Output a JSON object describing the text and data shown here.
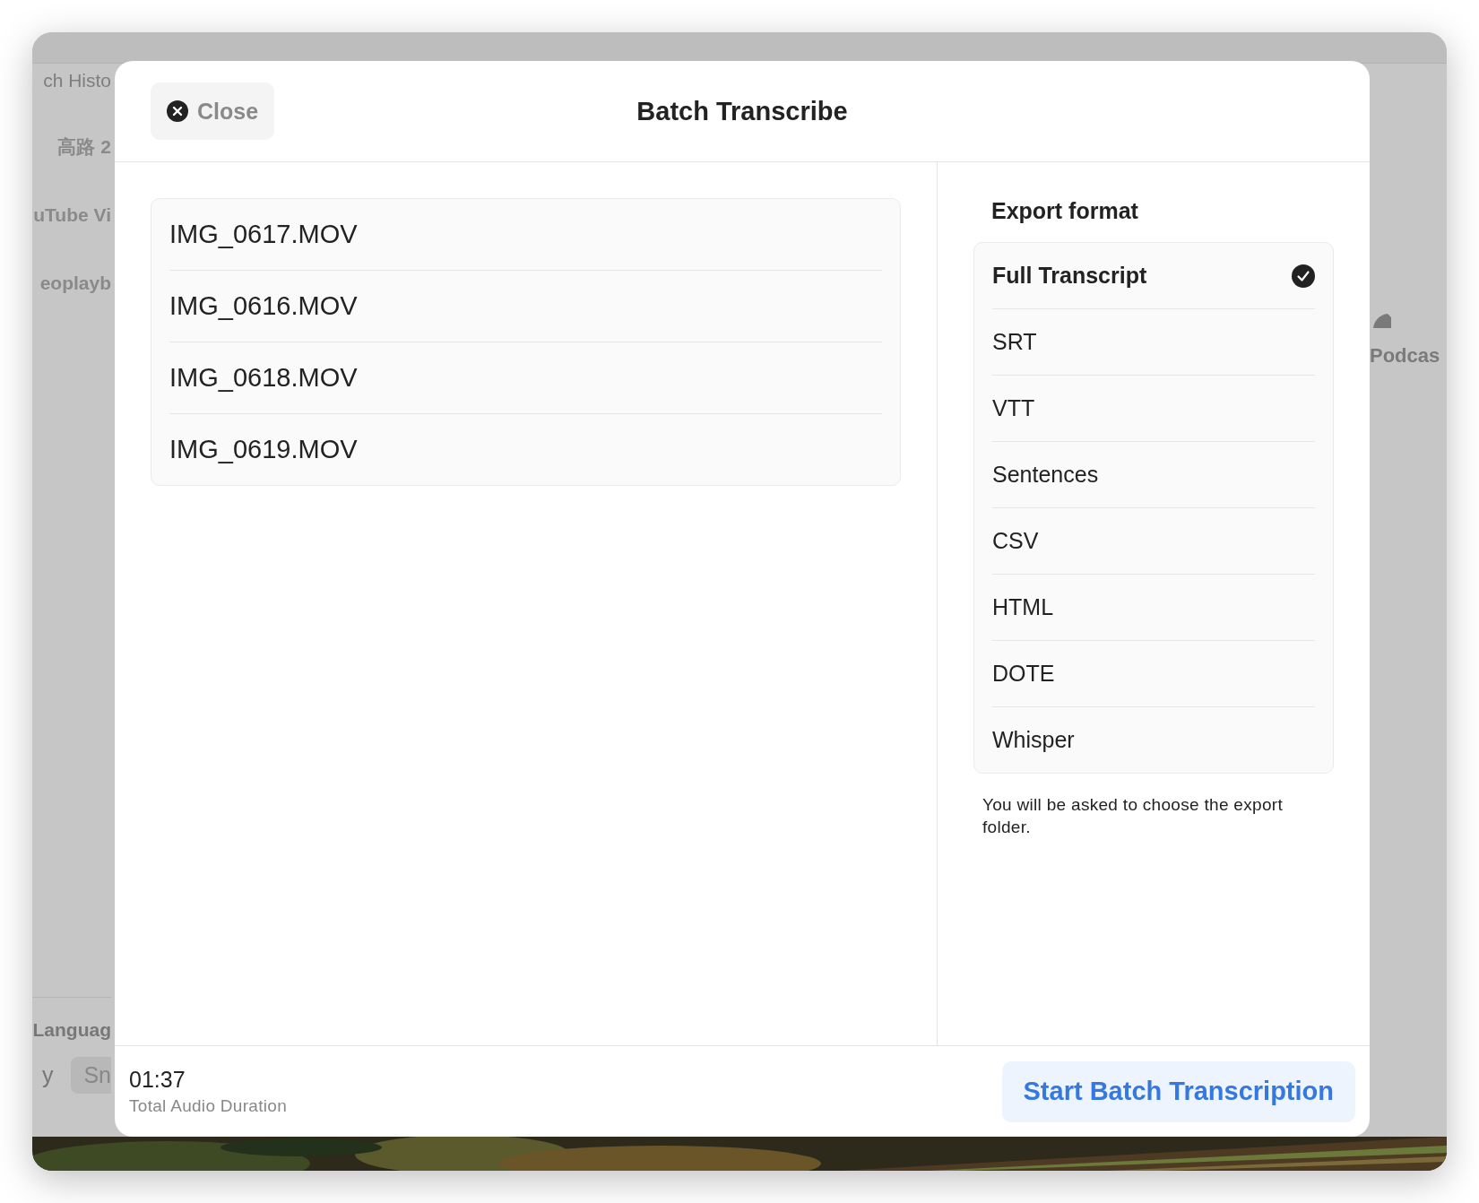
{
  "background": {
    "sidebar_items": [
      "ch Histo",
      "高路 2",
      "uTube Vi",
      "eoplayb"
    ],
    "bottom_heading": "Languag",
    "bottom_items": [
      "y",
      "Sn"
    ],
    "right_label": "Podcas"
  },
  "dialog": {
    "close_button": "Close",
    "title": "Batch Transcribe",
    "files": [
      "IMG_0617.MOV",
      "IMG_0616.MOV",
      "IMG_0618.MOV",
      "IMG_0619.MOV"
    ],
    "export_heading": "Export format",
    "formats": [
      {
        "label": "Full Transcript",
        "selected": true
      },
      {
        "label": "SRT",
        "selected": false
      },
      {
        "label": "VTT",
        "selected": false
      },
      {
        "label": "Sentences",
        "selected": false
      },
      {
        "label": "CSV",
        "selected": false
      },
      {
        "label": "HTML",
        "selected": false
      },
      {
        "label": "DOTE",
        "selected": false
      },
      {
        "label": "Whisper",
        "selected": false
      }
    ],
    "note": "You will be asked to choose the export folder.",
    "duration": "01:37",
    "duration_label": "Total Audio Duration",
    "start_button": "Start Batch Transcription"
  }
}
